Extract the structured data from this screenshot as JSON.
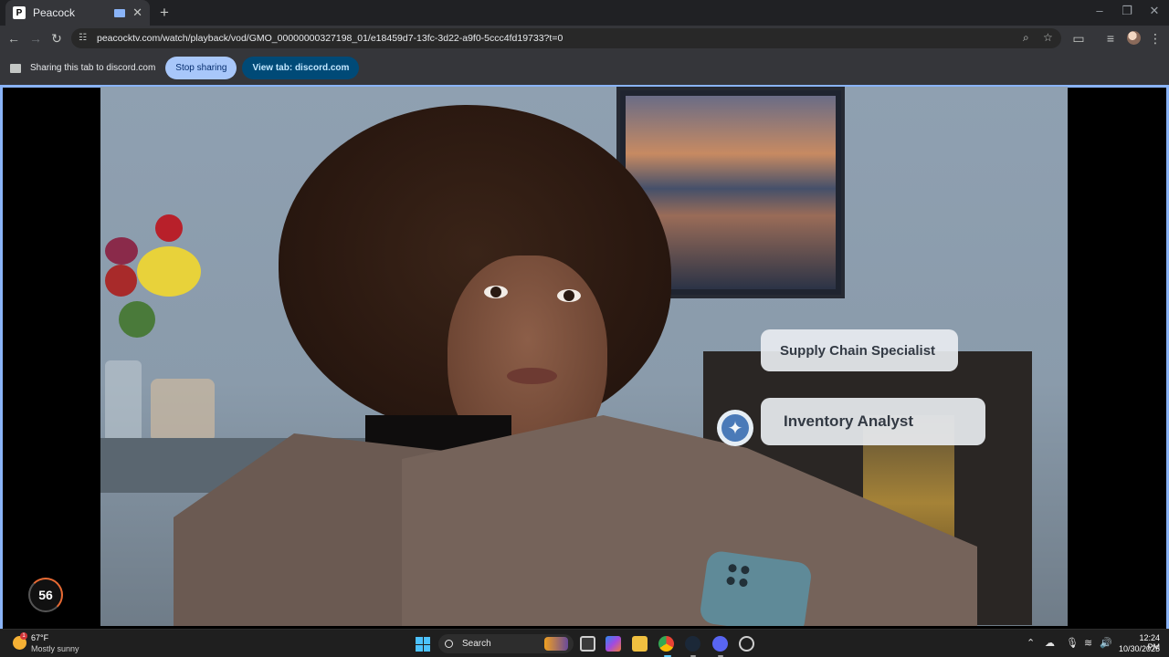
{
  "browser": {
    "tab_title": "Peacock",
    "tab_favicon_letter": "P",
    "url": "peacocktv.com/watch/playback/vod/GMO_00000000327198_01/e18459d7-13fc-3d22-a9f0-5ccc4fd19733?t=0"
  },
  "sharebar": {
    "message": "Sharing this tab to discord.com",
    "stop_label": "Stop sharing",
    "view_label": "View tab: discord.com"
  },
  "video": {
    "overlay_option_1": "Supply Chain Specialist",
    "overlay_option_2": "Inventory Analyst",
    "counter": "56"
  },
  "taskbar": {
    "weather_temp": "67°F",
    "weather_desc": "Mostly sunny",
    "weather_badge": "1",
    "search_label": "Search",
    "time": "12:24 PM",
    "date": "10/30/2025"
  },
  "colors": {
    "accent": "#8ab4f8",
    "stop_button": "#a8c7fa",
    "view_button": "#004a77"
  }
}
